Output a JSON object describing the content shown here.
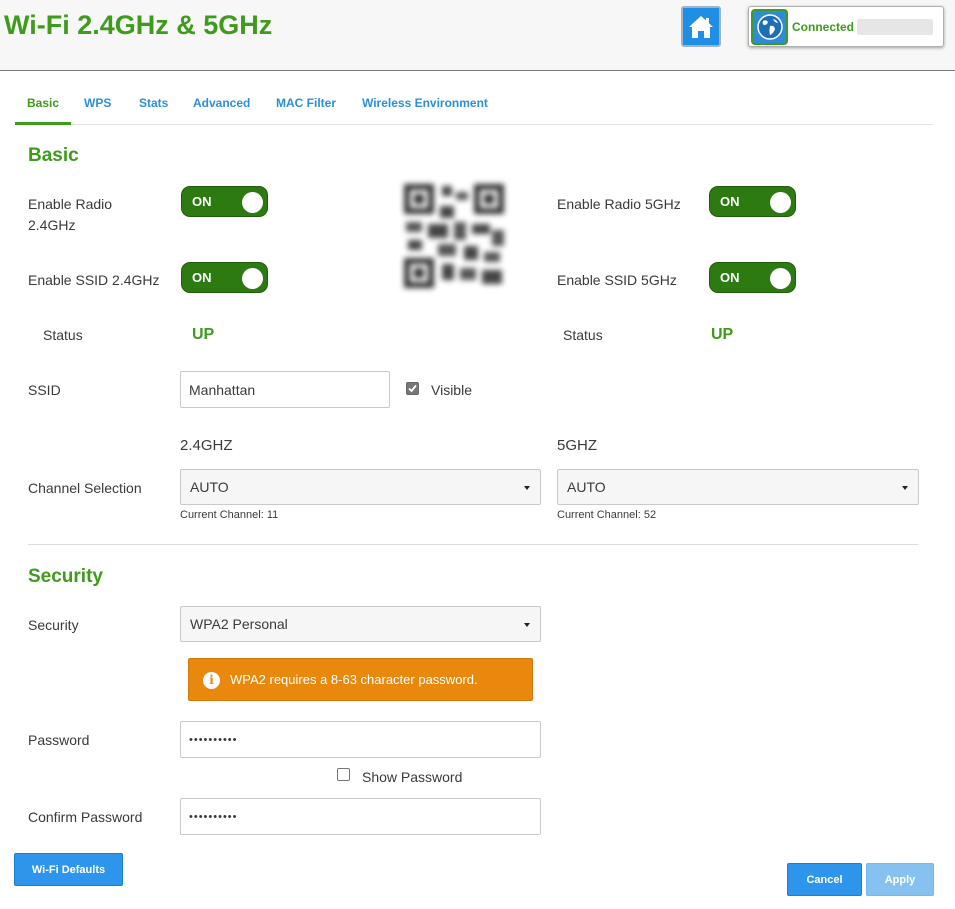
{
  "header": {
    "title": "Wi-Fi 2.4GHz & 5GHz",
    "home_icon": "home-icon",
    "globe_icon": "globe-icon",
    "connection_status": "Connected"
  },
  "tabs": [
    {
      "label": "Basic",
      "active": true
    },
    {
      "label": "WPS",
      "active": false
    },
    {
      "label": "Stats",
      "active": false
    },
    {
      "label": "Advanced",
      "active": false
    },
    {
      "label": "MAC Filter",
      "active": false
    },
    {
      "label": "Wireless Environment",
      "active": false
    }
  ],
  "basic": {
    "title": "Basic",
    "enable_radio_24_label": "Enable Radio 2.4GHz",
    "enable_radio_24_line1": "Enable Radio",
    "enable_radio_24_line2": "2.4GHz",
    "enable_radio_24_value": "ON",
    "enable_radio_5_label": "Enable Radio 5GHz",
    "enable_radio_5_value": "ON",
    "enable_ssid_24_label": "Enable SSID 2.4GHz",
    "enable_ssid_24_value": "ON",
    "enable_ssid_5_label": "Enable SSID 5GHz",
    "enable_ssid_5_value": "ON",
    "status_label_24": "Status",
    "status_value_24": "UP",
    "status_label_5": "Status",
    "status_value_5": "UP",
    "ssid_label": "SSID",
    "ssid_value": "Manhattan",
    "visible_label": "Visible",
    "visible_checked": true,
    "band_24_label": "2.4GHZ",
    "band_5_label": "5GHZ",
    "channel_selection_label": "Channel Selection",
    "channel_24_value": "AUTO",
    "channel_5_value": "AUTO",
    "current_channel_24": "Current Channel: 11",
    "current_channel_5": "Current Channel: 52"
  },
  "security": {
    "title": "Security",
    "security_label": "Security",
    "security_value": "WPA2 Personal",
    "alert_icon": "info-icon",
    "alert_text": "WPA2 requires a 8-63 character password.",
    "alert_color": "#e8880c",
    "password_label": "Password",
    "password_value": "••••••••••",
    "show_password_label": "Show Password",
    "show_password_checked": false,
    "confirm_password_label": "Confirm Password",
    "confirm_password_value": "••••••••••"
  },
  "buttons": {
    "wifi_defaults": "Wi-Fi Defaults",
    "cancel": "Cancel",
    "apply": "Apply"
  },
  "colors": {
    "brand_green": "#3e9b1b",
    "toggle_green": "#2d7a12",
    "link_blue": "#2d8fd8",
    "button_blue": "#2d95ec"
  }
}
